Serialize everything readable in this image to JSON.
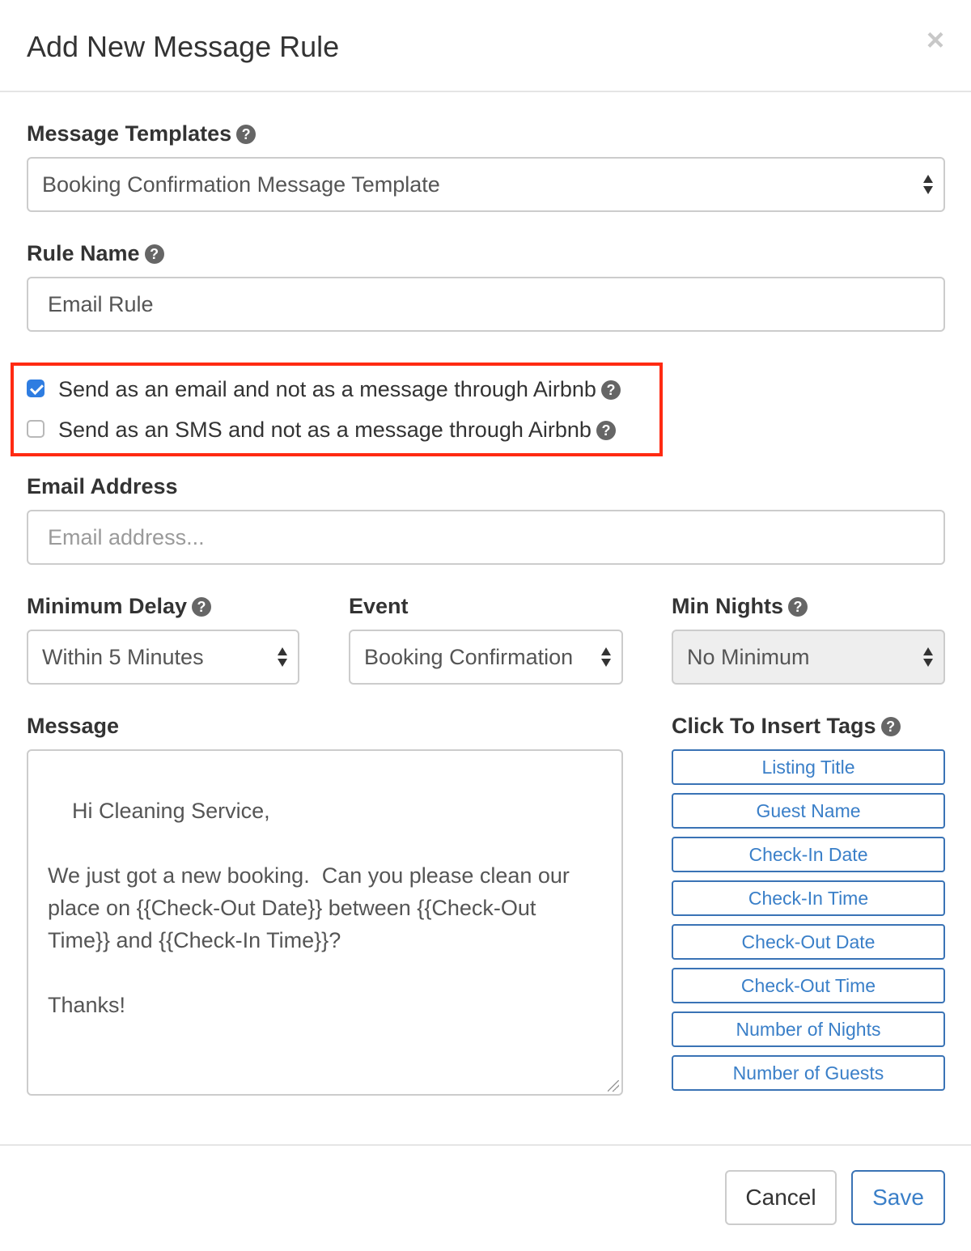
{
  "modal": {
    "title": "Add New Message Rule",
    "close_label": "×"
  },
  "fields": {
    "message_templates": {
      "label": "Message Templates",
      "selected": "Booking Confirmation Message Template"
    },
    "rule_name": {
      "label": "Rule Name",
      "value": "Email Rule"
    },
    "options": [
      {
        "label": "Send as an email and not as a message through Airbnb",
        "checked": true
      },
      {
        "label": "Send as an SMS and not as a message through Airbnb",
        "checked": false
      }
    ],
    "email_address": {
      "label": "Email Address",
      "placeholder": "Email address..."
    },
    "minimum_delay": {
      "label": "Minimum Delay",
      "selected": "Within 5 Minutes"
    },
    "event": {
      "label": "Event",
      "selected": "Booking Confirmation"
    },
    "min_nights": {
      "label": "Min Nights",
      "selected": "No Minimum",
      "disabled": true
    },
    "message": {
      "label": "Message",
      "value": "Hi Cleaning Service,\n\nWe just got a new booking.  Can you please clean our place on {{Check-Out Date}} between {{Check-Out Time}} and {{Check-In Time}}?\n\nThanks!"
    }
  },
  "tags": {
    "label": "Click To Insert Tags",
    "items": [
      "Listing Title",
      "Guest Name",
      "Check-In Date",
      "Check-In Time",
      "Check-Out Date",
      "Check-Out Time",
      "Number of Nights",
      "Number of Guests"
    ]
  },
  "footer": {
    "cancel_label": "Cancel",
    "save_label": "Save"
  },
  "icons": {
    "help": "question-circle-icon",
    "close": "close-icon",
    "checkbox_checked_color": "#2f7de1",
    "highlight_color": "#ff2a12",
    "accent_color": "#3a7fc8"
  }
}
